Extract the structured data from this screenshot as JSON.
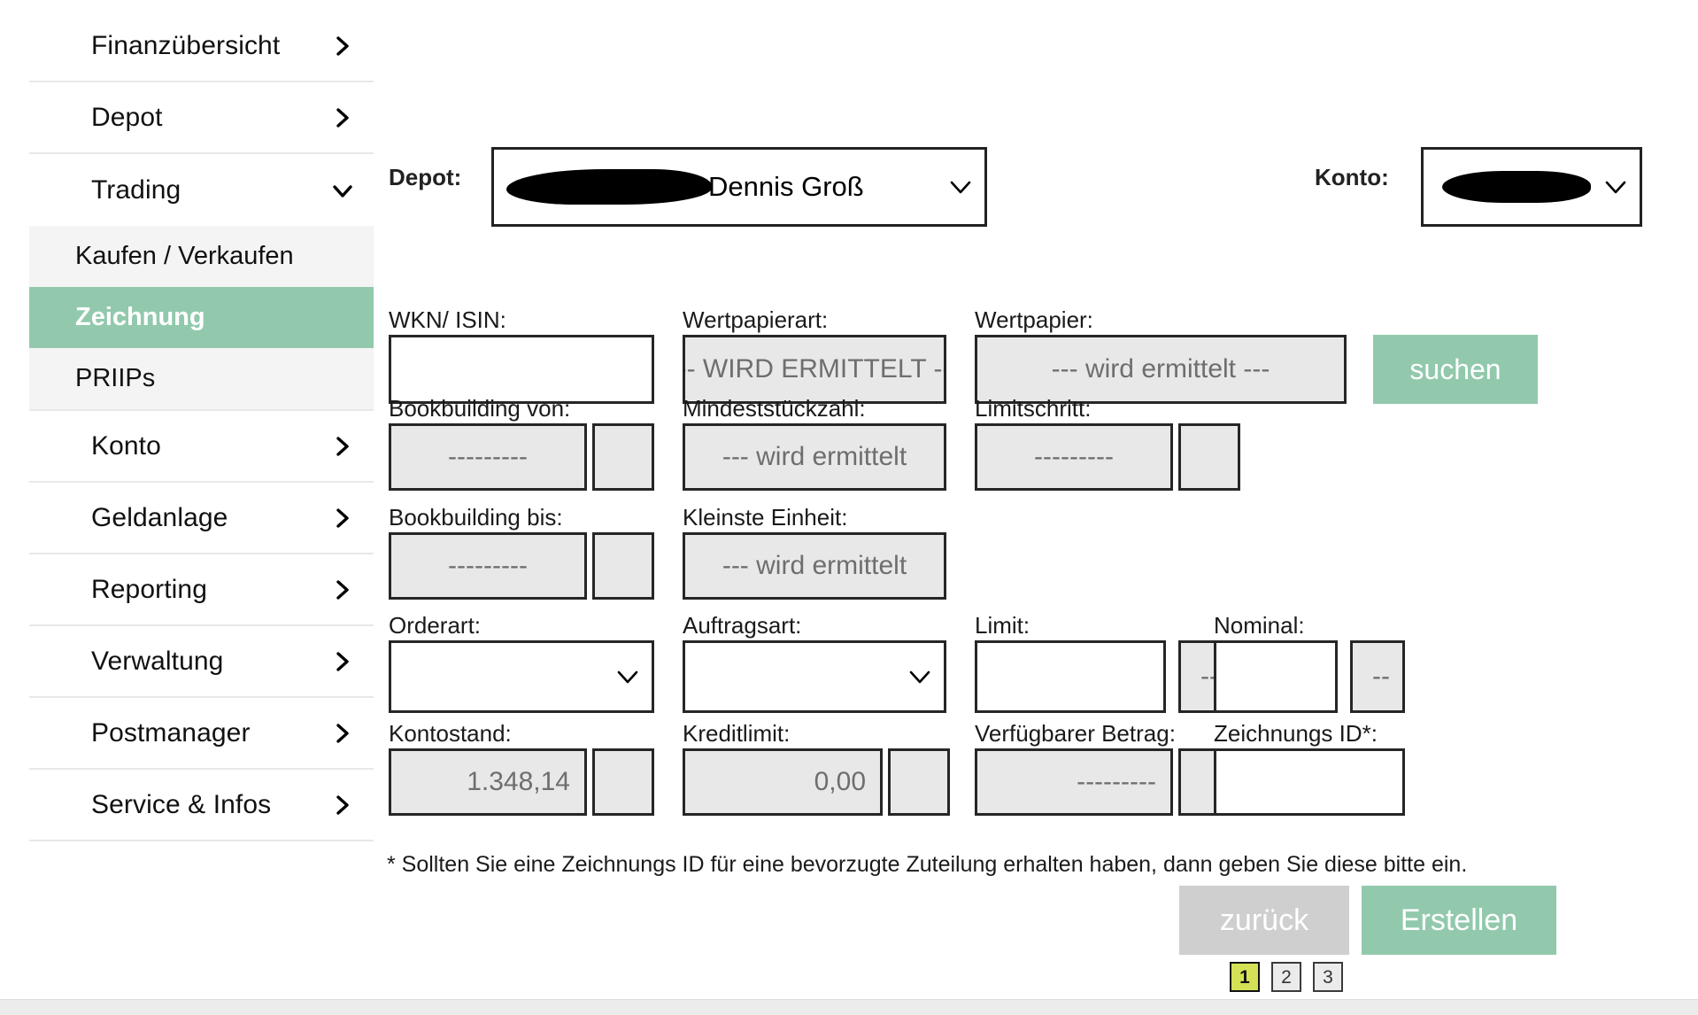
{
  "sidebar": {
    "items": [
      {
        "label": "Finanzübersicht",
        "icon": "chevron-right-icon",
        "expanded": false
      },
      {
        "label": "Depot",
        "icon": "chevron-right-icon",
        "expanded": false
      },
      {
        "label": "Trading",
        "icon": "chevron-down-icon",
        "expanded": true
      },
      {
        "label": "Konto",
        "icon": "chevron-right-icon",
        "expanded": false
      },
      {
        "label": "Geldanlage",
        "icon": "chevron-right-icon",
        "expanded": false
      },
      {
        "label": "Reporting",
        "icon": "chevron-right-icon",
        "expanded": false
      },
      {
        "label": "Verwaltung",
        "icon": "chevron-right-icon",
        "expanded": false
      },
      {
        "label": "Postmanager",
        "icon": "chevron-right-icon",
        "expanded": false
      },
      {
        "label": "Service & Infos",
        "icon": "chevron-right-icon",
        "expanded": false
      }
    ],
    "trading_subitems": [
      {
        "label": "Kaufen / Verkaufen",
        "active": false
      },
      {
        "label": "Zeichnung",
        "active": true
      },
      {
        "label": "PRIIPs",
        "active": false
      }
    ]
  },
  "header": {
    "depot_label": "Depot:",
    "depot_value": "Dennis Groß",
    "depot_redacted": true,
    "konto_label": "Konto:",
    "konto_value": "",
    "konto_redacted": true,
    "dropdown_icon": "chevron-down-icon"
  },
  "form": {
    "wkn_isin": {
      "label": "WKN/ ISIN:",
      "value": "",
      "readonly": false
    },
    "wertpapierart": {
      "label": "Wertpapierart:",
      "value": "--- WIRD ERMITTELT ---",
      "readonly": true
    },
    "wertpapier": {
      "label": "Wertpapier:",
      "value": "--- wird ermittelt ---",
      "readonly": true
    },
    "search_button": {
      "label": "suchen",
      "icon": "search-button"
    },
    "bookbuilding_von": {
      "label": "Bookbuilding von:",
      "value": "---------",
      "suffix": "",
      "readonly": true
    },
    "mindeststueckzahl": {
      "label": "Mindeststückzahl:",
      "value": "--- wird ermittelt",
      "readonly": true
    },
    "limitschritt": {
      "label": "Limitschritt:",
      "value": "---------",
      "suffix": "",
      "readonly": true
    },
    "bookbuilding_bis": {
      "label": "Bookbuilding bis:",
      "value": "---------",
      "suffix": "",
      "readonly": true
    },
    "kleinste_einheit": {
      "label": "Kleinste Einheit:",
      "value": "--- wird ermittelt",
      "readonly": true
    },
    "orderart": {
      "label": "Orderart:",
      "value": "",
      "icon": "chevron-down-icon"
    },
    "auftragsart": {
      "label": "Auftragsart:",
      "value": "",
      "icon": "chevron-down-icon"
    },
    "limit": {
      "label": "Limit:",
      "value": "",
      "suffix": "--",
      "readonly": false
    },
    "nominal": {
      "label": "Nominal:",
      "value": "",
      "suffix": "--",
      "readonly": false
    },
    "kontostand": {
      "label": "Kontostand:",
      "value": "1.348,14",
      "suffix": "",
      "readonly": true
    },
    "kreditlimit": {
      "label": "Kreditlimit:",
      "value": "0,00",
      "suffix": "",
      "readonly": true
    },
    "verfuegbarer_betrag": {
      "label": "Verfügbarer Betrag:",
      "value": "---------",
      "suffix": "",
      "readonly": true
    },
    "zeichnungs_id": {
      "label": "Zeichnungs ID*:",
      "value": "",
      "readonly": false
    },
    "footnote": "* Sollten Sie eine Zeichnungs ID für eine bevorzugte Zuteilung erhalten haben, dann geben Sie diese bitte ein."
  },
  "actions": {
    "back_label": "zurück",
    "submit_label": "Erstellen"
  },
  "pagination": {
    "pages": [
      "1",
      "2",
      "3"
    ],
    "current": "1"
  },
  "colors": {
    "accent_green": "#92c9ad",
    "readonly_gray": "#e8e8e8",
    "back_gray": "#cfcfcf",
    "pager_active": "#d4e157",
    "subnav_gray": "#f4f4f4"
  }
}
